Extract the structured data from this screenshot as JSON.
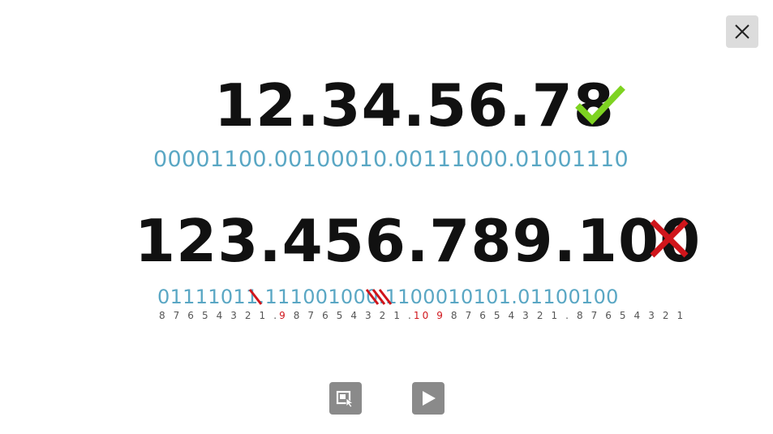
{
  "slide": {
    "valid_ip": "12.34.56.78",
    "valid_binary": "00001100.00100010.00111000.01001110",
    "invalid_ip": "123.456.789.100",
    "invalid_binary": "01111011.111001000.1100010101.01100100",
    "bit_positions": [
      {
        "text": "8 7 6 5 4 3 2 1 .",
        "overflow": false
      },
      {
        "text": "9",
        "overflow": true
      },
      {
        "text": " 8 7 6 5 4 3 2 1 .",
        "overflow": false
      },
      {
        "text": "10 9",
        "overflow": true
      },
      {
        "text": " 8 7 6 5 4 3 2 1 . 8 7 6 5 4 3 2 1",
        "overflow": false
      }
    ],
    "valid_icon": "checkmark-icon",
    "invalid_icon": "cross-icon",
    "colors": {
      "check": "#7ed321",
      "cross": "#d0151b",
      "binary": "#5aa7c4",
      "ip_text": "#111111"
    }
  },
  "controls": {
    "close_icon": "close-icon",
    "zoom_icon": "zoom-select-icon",
    "play_icon": "play-icon"
  }
}
